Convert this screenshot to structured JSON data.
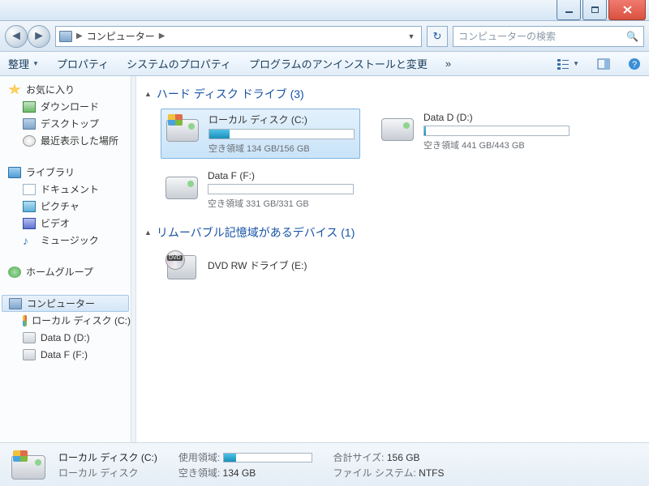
{
  "breadcrumb": {
    "root_item": "コンピューター"
  },
  "search": {
    "placeholder": "コンピューターの検索"
  },
  "toolbar": {
    "organize": "整理",
    "properties": "プロパティ",
    "sys_properties": "システムのプロパティ",
    "uninstall": "プログラムのアンインストールと変更",
    "more": "»"
  },
  "sidebar": {
    "fav_header": "お気に入り",
    "favs": [
      {
        "label": "ダウンロード",
        "icon": "dl"
      },
      {
        "label": "デスクトップ",
        "icon": "monitor"
      },
      {
        "label": "最近表示した場所",
        "icon": "clock"
      }
    ],
    "lib_header": "ライブラリ",
    "libs": [
      {
        "label": "ドキュメント",
        "icon": "doc"
      },
      {
        "label": "ピクチャ",
        "icon": "pic"
      },
      {
        "label": "ビデオ",
        "icon": "vid"
      },
      {
        "label": "ミュージック",
        "icon": "mus",
        "glyph": "♪"
      }
    ],
    "homegroup": "ホームグループ",
    "computer": "コンピューター",
    "computer_children": [
      {
        "label": "ローカル ディスク (C:)",
        "icon": "winlogo"
      },
      {
        "label": "Data D (D:)",
        "icon": "drive"
      },
      {
        "label": "Data F (F:)",
        "icon": "drive"
      }
    ]
  },
  "groups": {
    "hdd_header": "ハード ディスク ドライブ (3)",
    "rem_header": "リムーバブル記憶域があるデバイス (1)"
  },
  "drives": {
    "c": {
      "name": "ローカル ディスク (C:)",
      "free_text": "空き領域 134 GB/156 GB",
      "used_pct": 14
    },
    "d": {
      "name": "Data D (D:)",
      "free_text": "空き領域 441 GB/443 GB",
      "used_pct": 1
    },
    "f": {
      "name": "Data F (F:)",
      "free_text": "空き領域 331 GB/331 GB",
      "used_pct": 0
    },
    "dvd": {
      "name": "DVD RW ドライブ (E:)",
      "badge": "DVD"
    }
  },
  "details": {
    "title": "ローカル ディスク (C:)",
    "subtitle": "ローカル ディスク",
    "labels": {
      "used": "使用領域:",
      "free": "空き領域:",
      "total": "合計サイズ:",
      "fs": "ファイル システム:"
    },
    "free": "134 GB",
    "total": "156 GB",
    "fs": "NTFS",
    "used_pct": 14
  }
}
